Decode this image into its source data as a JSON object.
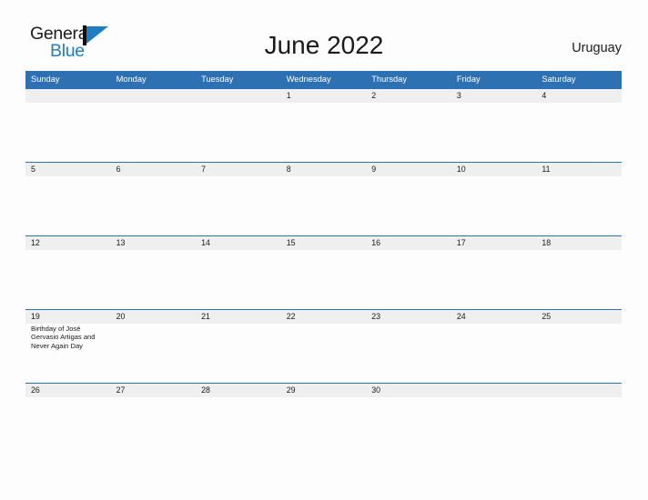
{
  "brand": {
    "name_part1": "General",
    "name_part2": "Blue",
    "mark_icon": "blue-triangle-flag-icon"
  },
  "header": {
    "title": "June 2022",
    "country": "Uruguay"
  },
  "colors": {
    "header_blue": "#2e71b2",
    "band_gray": "#efefef",
    "page_background": "#fdfdfd",
    "brand_blue": "#1f7dc4",
    "text_dark": "#1a1a1a"
  },
  "calendar": {
    "weekdays": [
      "Sunday",
      "Monday",
      "Tuesday",
      "Wednesday",
      "Thursday",
      "Friday",
      "Saturday"
    ],
    "weeks": [
      {
        "dates": [
          "",
          "",
          "",
          "1",
          "2",
          "3",
          "4"
        ],
        "events": [
          "",
          "",
          "",
          "",
          "",
          "",
          ""
        ]
      },
      {
        "dates": [
          "5",
          "6",
          "7",
          "8",
          "9",
          "10",
          "11"
        ],
        "events": [
          "",
          "",
          "",
          "",
          "",
          "",
          ""
        ]
      },
      {
        "dates": [
          "12",
          "13",
          "14",
          "15",
          "16",
          "17",
          "18"
        ],
        "events": [
          "",
          "",
          "",
          "",
          "",
          "",
          ""
        ]
      },
      {
        "dates": [
          "19",
          "20",
          "21",
          "22",
          "23",
          "24",
          "25"
        ],
        "events": [
          "Birthday of José Gervasio Artigas and Never Again Day",
          "",
          "",
          "",
          "",
          "",
          ""
        ]
      },
      {
        "dates": [
          "26",
          "27",
          "28",
          "29",
          "30",
          "",
          ""
        ],
        "events": [
          "",
          "",
          "",
          "",
          "",
          "",
          ""
        ]
      }
    ]
  }
}
